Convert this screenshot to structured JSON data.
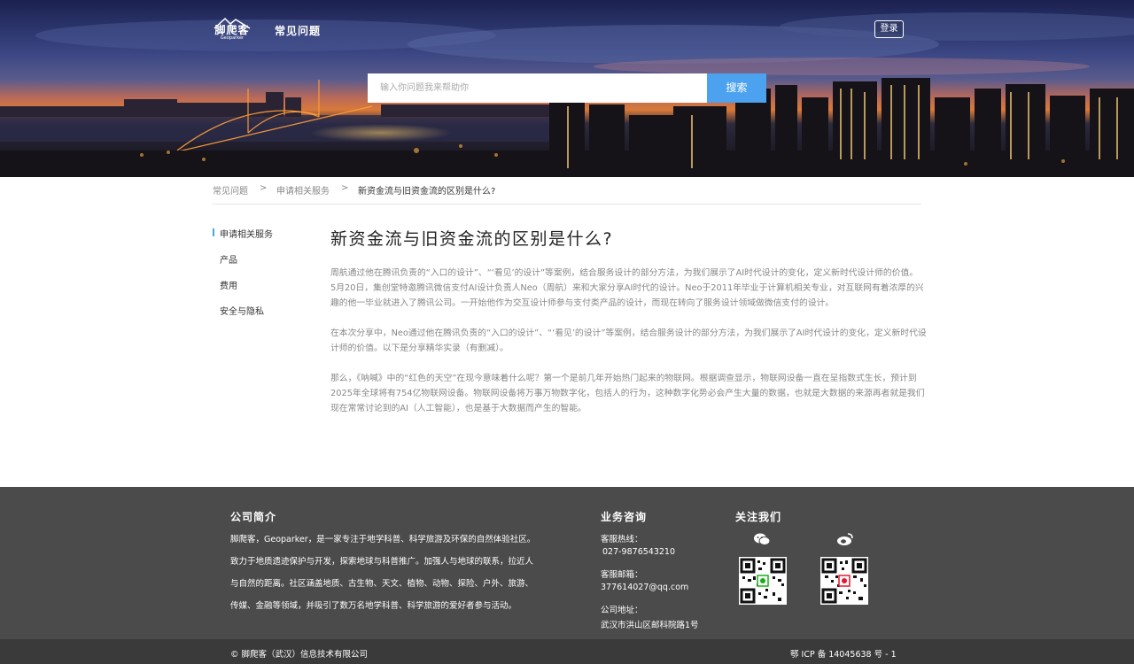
{
  "header": {
    "logo_text": "脚爬客",
    "logo_sub": "Geoparker",
    "site_title": "常见问题",
    "login_label": "登录"
  },
  "search": {
    "placeholder": "输入你问题我来帮助你",
    "button_label": "搜索"
  },
  "breadcrumb": {
    "items": [
      "常见问题",
      "申请相关服务",
      "新资金流与旧资金流的区别是什么?"
    ],
    "separator": ">"
  },
  "sidebar": {
    "items": [
      {
        "label": "申请相关服务",
        "active": true
      },
      {
        "label": "产品",
        "active": false
      },
      {
        "label": "费用",
        "active": false
      },
      {
        "label": "安全与隐私",
        "active": false
      }
    ]
  },
  "article": {
    "title": "新资金流与旧资金流的区别是什么?",
    "paragraphs": [
      "周航通过他在腾讯负责的“入口的设计”、“‘看见’的设计”等案例，结合服务设计的部分方法，为我们展示了AI时代设计的变化，定义新时代设计师的价值。",
      "5月20日，集创堂特邀腾讯微信支付AI设计负责人Neo（周航）来和大家分享AI时代的设计。Neo于2011年毕业于计算机相关专业，对互联网有着浓厚的兴趣的他一毕业就进入了腾讯公司。一开始他作为交互设计师参与支付类产品的设计，而现在转向了服务设计领域做微信支付的设计。",
      "在本次分享中，Neo通过他在腾讯负责的“入口的设计”、“‘看见’的设计”等案例，结合服务设计的部分方法，为我们展示了AI时代设计的变化，定义新时代设计师的价值。以下是分享精华实录（有删减）。",
      "那么，《呐喊》中的“红色的天空”在现今意味着什么呢？第一个是前几年开始热门起来的物联网。根据调查显示，物联网设备一直在呈指数式生长，预计到2025年全球将有754亿物联网设备。物联网设备将万事万物数字化，包括人的行为，这种数字化势必会产生大量的数据，也就是大数据的来源再者就是我们现在常常讨论到的AI（人工智能），也是基于大数据而产生的智能。"
    ]
  },
  "footer": {
    "about_title": "公司简介",
    "about_lines": [
      "脚爬客，Geoparker，是一家专注于地学科普、科学旅游及环保的自然体验社区。",
      "致力于地质遗迹保护与开发，探索地球与科普推广。加强人与地球的联系，拉近人",
      "与自然的距离。社区涵盖地质、古生物、天文、植物、动物、探险、户外、旅游、",
      "传媒、金融等领域，并吸引了数万名地学科普、科学旅游的爱好者参与活动。"
    ],
    "business_title": "业务咨询",
    "hotline_label": "客服热线：",
    "hotline": "027-9876543210",
    "email_label": "客服邮箱：",
    "email": "377614027@qq.com",
    "address_label": "公司地址：",
    "address": "武汉市洪山区邮科院路1号",
    "follow_title": "关注我们",
    "social": [
      "wechat-icon",
      "weibo-icon"
    ],
    "copyright": "© 脚爬客（武汉）信息技术有限公司",
    "icp": "鄂 ICP 备 14045638 号 - 1"
  },
  "colors": {
    "accent": "#4da2f0",
    "footer_bg": "#4b4b4b",
    "footer_bottom_bg": "#3a3a3a"
  }
}
